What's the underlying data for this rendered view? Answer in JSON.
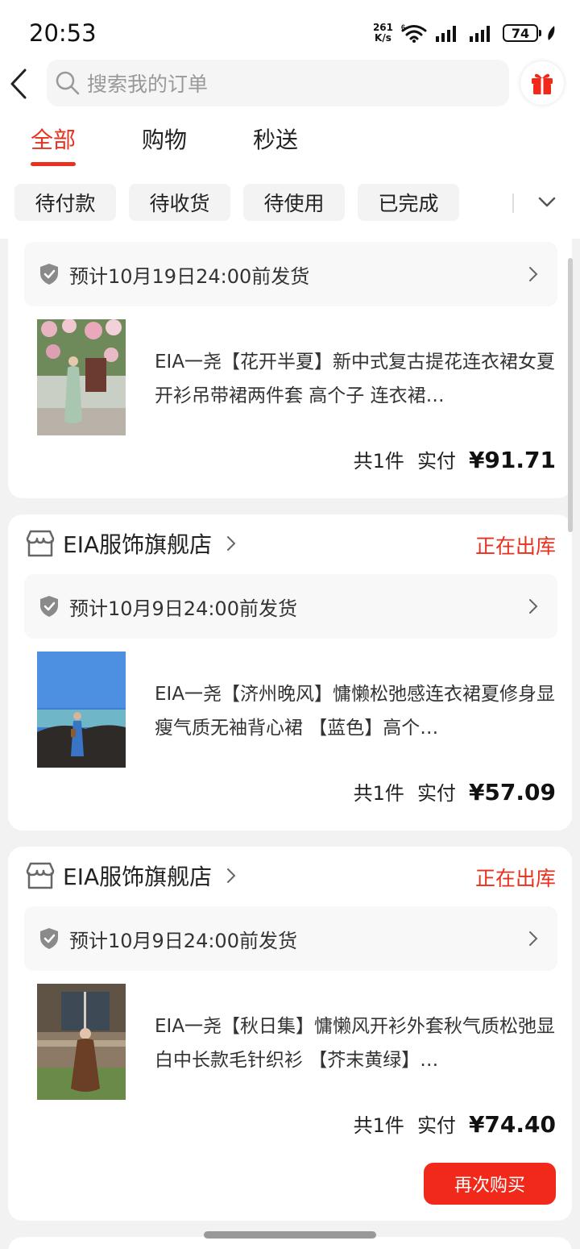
{
  "status_bar": {
    "time": "20:53",
    "net_speed": "261",
    "net_unit": "K/s",
    "wifi_badge": "6",
    "battery": "74"
  },
  "search": {
    "placeholder": "搜索我的订单"
  },
  "tabs": [
    {
      "label": "全部",
      "active": true
    },
    {
      "label": "购物",
      "active": false
    },
    {
      "label": "秒送",
      "active": false
    }
  ],
  "filters": [
    "待付款",
    "待收货",
    "待使用",
    "已完成"
  ],
  "orders": [
    {
      "store": "",
      "status": "",
      "shipping": "预计10月19日24:00前发货",
      "title": "EIA一尧【花开半夏】新中式复古提花连衣裙女夏开衫吊带裙两件套 高个子 连衣裙…",
      "count": "共1件",
      "paid_label": "实付",
      "amount": "¥91.71",
      "image": "woman-in-floral-dress-photo"
    },
    {
      "store": "EIA服饰旗舰店",
      "status": "正在出库",
      "shipping": "预计10月9日24:00前发货",
      "title": "EIA一尧【济州晚风】慵懒松弛感连衣裙夏修身显瘦气质无袖背心裙 【蓝色】高个…",
      "count": "共1件",
      "paid_label": "实付",
      "amount": "¥57.09",
      "image": "woman-by-sea-photo"
    },
    {
      "store": "EIA服饰旗舰店",
      "status": "正在出库",
      "shipping": "预计10月9日24:00前发货",
      "title": "EIA一尧【秋日集】慵懒风开衫外套秋气质松弛显白中长款毛针织衫 【芥末黄绿】…",
      "count": "共1件",
      "paid_label": "实付",
      "amount": "¥74.40",
      "image": "woman-seated-brown-dress-photo",
      "button": "再次购买"
    }
  ],
  "colors": {
    "accent": "#e8321f",
    "button": "#f0291a"
  }
}
